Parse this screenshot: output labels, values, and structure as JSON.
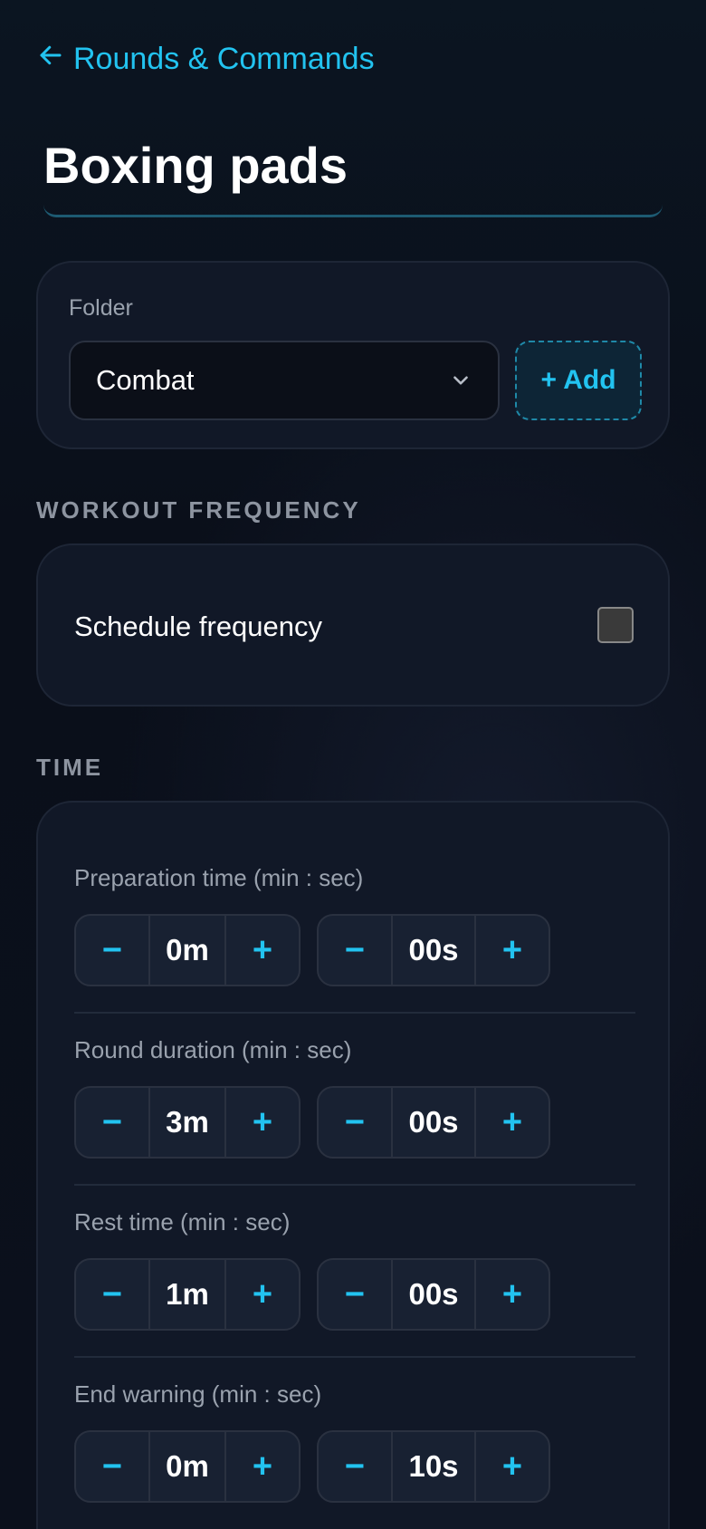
{
  "header": {
    "back_label": "Rounds & Commands",
    "title_value": "Boxing pads"
  },
  "folder": {
    "label": "Folder",
    "selected": "Combat",
    "add_label": "+ Add"
  },
  "frequency": {
    "section_label": "WORKOUT FREQUENCY",
    "schedule_label": "Schedule frequency",
    "checked": false
  },
  "time": {
    "section_label": "TIME",
    "rows": [
      {
        "label": "Preparation time (min : sec)",
        "minutes": "0m",
        "seconds": "00s"
      },
      {
        "label": "Round duration (min : sec)",
        "minutes": "3m",
        "seconds": "00s"
      },
      {
        "label": "Rest time (min : sec)",
        "minutes": "1m",
        "seconds": "00s"
      },
      {
        "label": "End warning (min : sec)",
        "minutes": "0m",
        "seconds": "10s"
      }
    ],
    "minus_symbol": "−",
    "plus_symbol": "+"
  },
  "colors": {
    "accent": "#22c3f0",
    "card_bg": "#111827",
    "page_bg": "#0a0f1a"
  }
}
